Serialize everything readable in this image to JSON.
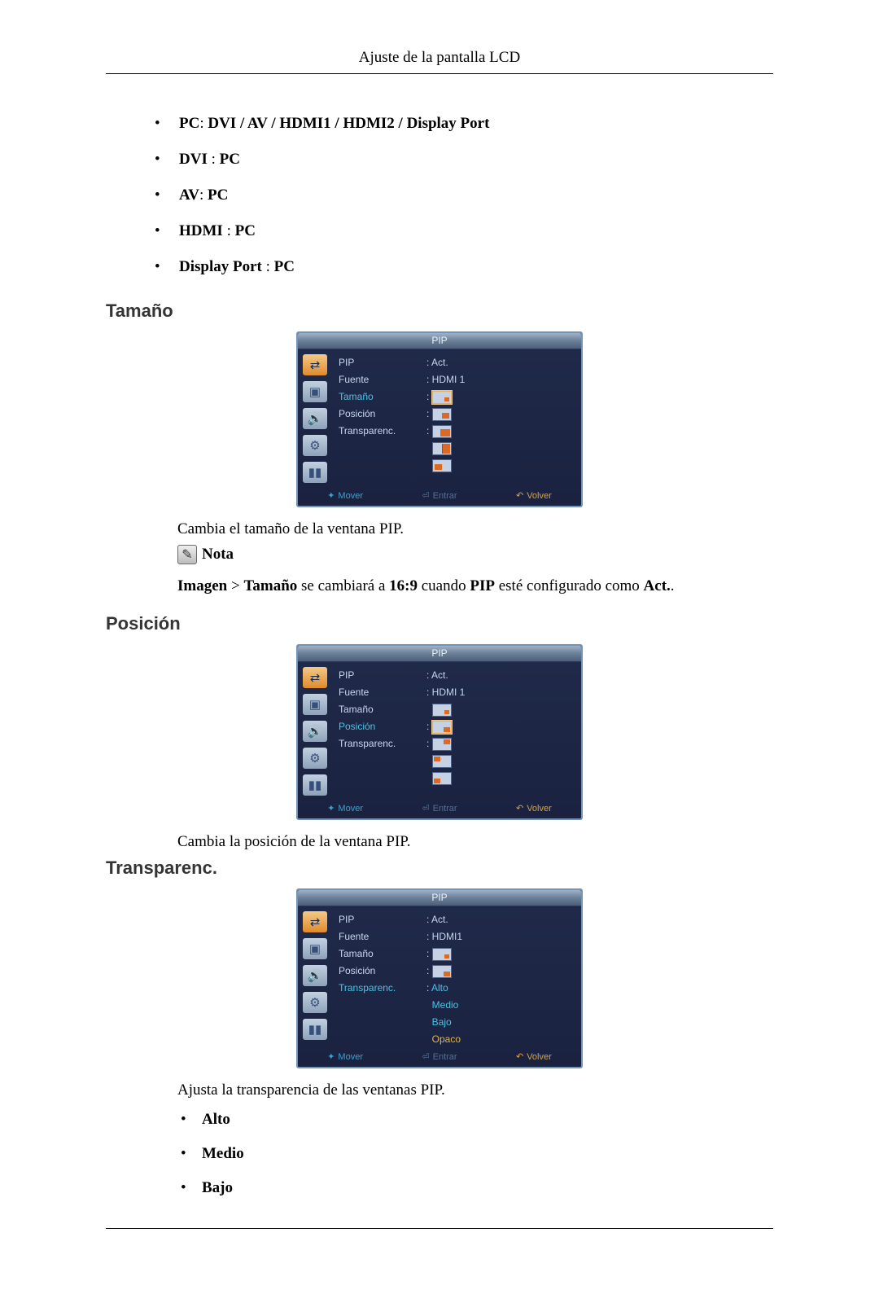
{
  "header": {
    "title": "Ajuste de la pantalla LCD"
  },
  "sources": {
    "items": [
      {
        "label": "PC",
        "sep": ": ",
        "value": "DVI / AV / HDMI1 / HDMI2 / Display Port"
      },
      {
        "label": "DVI",
        "sep": " : ",
        "value": "PC"
      },
      {
        "label": "AV",
        "sep": ": ",
        "value": "PC"
      },
      {
        "label": "HDMI",
        "sep": " : ",
        "value": "PC"
      },
      {
        "label": "Display Port",
        "sep": " : ",
        "value": "PC"
      }
    ]
  },
  "sections": {
    "size": {
      "heading": "Tamaño",
      "caption": "Cambia el tamaño de la ventana PIP.",
      "note_label": "Nota",
      "note_text_parts": {
        "a": "Imagen",
        "b": " > ",
        "c": "Tamaño",
        "d": " se cambiará a ",
        "e": "16:9",
        "f": " cuando ",
        "g": "PIP",
        "h": " esté configurado como ",
        "i": "Act.",
        "j": "."
      }
    },
    "position": {
      "heading": "Posición",
      "caption": "Cambia la posición de la ventana PIP."
    },
    "transparency": {
      "heading": "Transparenc.",
      "caption": "Ajusta la transparencia de las ventanas PIP.",
      "options": [
        "Alto",
        "Medio",
        "Bajo"
      ]
    }
  },
  "osd": {
    "title": "PIP",
    "labels": {
      "pip": "PIP",
      "fuente": "Fuente",
      "tamano": "Tamaño",
      "posicion": "Posición",
      "transparenc": "Transparenc."
    },
    "values": {
      "pip": "Act.",
      "fuente": "HDMI 1",
      "fuente_nospace": "HDMI1",
      "trans_opts": {
        "alto": "Alto",
        "medio": "Medio",
        "bajo": "Bajo",
        "opaco": "Opaco"
      }
    },
    "footer": {
      "move": "Mover",
      "enter": "Entrar",
      "return": "Volver"
    }
  }
}
